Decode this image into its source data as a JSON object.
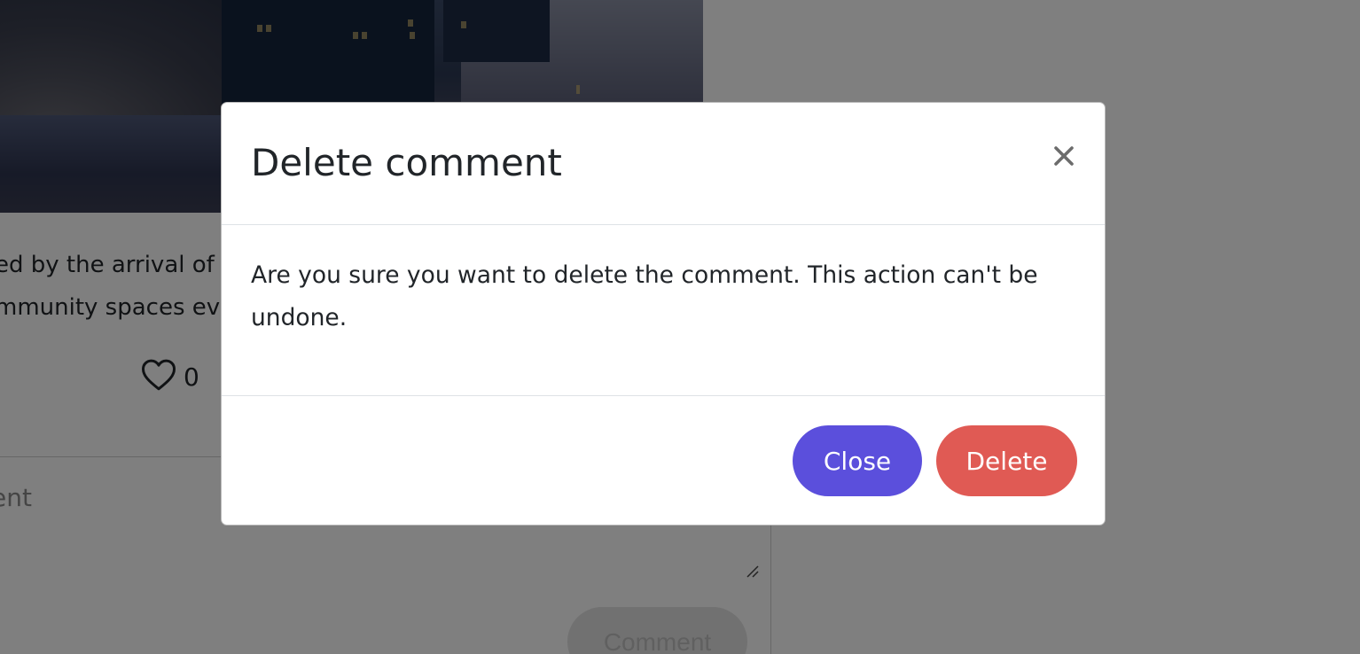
{
  "background": {
    "post_text_lines": [
      "ed by the arrival of",
      "mmunity spaces ev"
    ],
    "like_count": "0",
    "comment_placeholder": "ent",
    "comment_button_label": "Comment"
  },
  "modal": {
    "title": "Delete comment",
    "message": "Are you sure you want to delete the comment. This action can't be undone.",
    "close_label": "Close",
    "delete_label": "Delete"
  },
  "colors": {
    "close_button": "#5b4fdc",
    "delete_button": "#e05a54",
    "backdrop": "rgba(0,0,0,0.5)"
  },
  "icons": {
    "like": "heart-outline-icon",
    "dismiss": "close-x-icon"
  }
}
